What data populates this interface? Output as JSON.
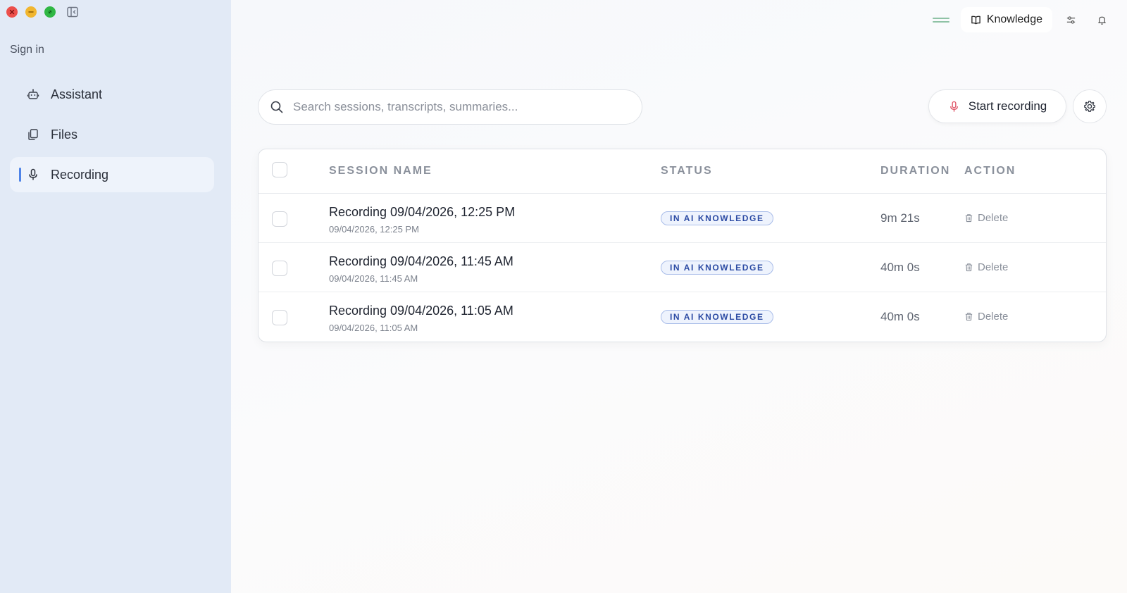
{
  "window": {
    "controls": [
      "close",
      "minimize",
      "zoom"
    ]
  },
  "sidebar": {
    "signin_label": "Sign in",
    "items": [
      {
        "label": "Assistant",
        "icon": "robot-icon",
        "active": false
      },
      {
        "label": "Files",
        "icon": "files-icon",
        "active": false
      },
      {
        "label": "Recording",
        "icon": "microphone-icon",
        "active": true
      }
    ]
  },
  "topbar": {
    "knowledge_label": "Knowledge"
  },
  "search": {
    "placeholder": "Search sessions, transcripts, summaries...",
    "value": ""
  },
  "actions": {
    "start_recording_label": "Start recording"
  },
  "table": {
    "headers": {
      "name": "SESSION NAME",
      "status": "STATUS",
      "duration": "DURATION",
      "action": "ACTION"
    },
    "rows": [
      {
        "name": "Recording 09/04/2026, 12:25 PM",
        "sub": "09/04/2026, 12:25 PM",
        "status": "IN AI KNOWLEDGE",
        "duration": "9m 21s",
        "action": "Delete"
      },
      {
        "name": "Recording 09/04/2026, 11:45 AM",
        "sub": "09/04/2026, 11:45 AM",
        "status": "IN AI KNOWLEDGE",
        "duration": "40m 0s",
        "action": "Delete"
      },
      {
        "name": "Recording 09/04/2026, 11:05 AM",
        "sub": "09/04/2026, 11:05 AM",
        "status": "IN AI KNOWLEDGE",
        "duration": "40m 0s",
        "action": "Delete"
      }
    ]
  },
  "colors": {
    "sidebar_bg": "#e2eaf6",
    "accent": "#4f84e8",
    "badge_text": "#2c4ba4",
    "record_icon": "#e0586a"
  }
}
